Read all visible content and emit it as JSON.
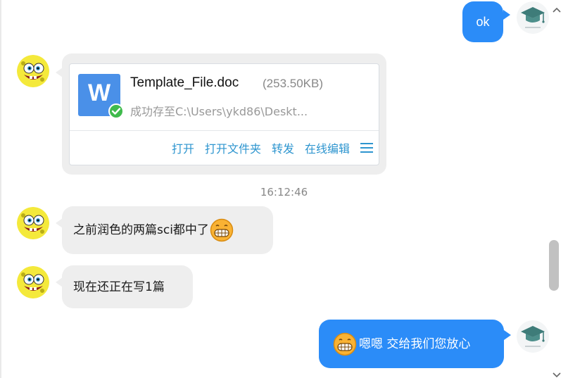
{
  "messages": [
    {
      "id": "m1",
      "direction": "out",
      "text": "ok"
    },
    {
      "id": "m2",
      "direction": "in",
      "type": "file"
    },
    {
      "id": "m3",
      "direction": "in",
      "text": "之前润色的两篇sci都中了",
      "emoji": "grin-emoji"
    },
    {
      "id": "m4",
      "direction": "in",
      "text": "现在还正在写1篇"
    },
    {
      "id": "m5",
      "direction": "out",
      "text": "嗯嗯 交给我们您放心",
      "emoji": "grin-emoji"
    }
  ],
  "file": {
    "icon_letter": "W",
    "name": "Template_File.doc",
    "size": "(253.50KB)",
    "status": "成功存至C:\\Users\\ykd86\\Deskt...",
    "actions": {
      "open": "打开",
      "open_folder": "打开文件夹",
      "forward": "转发",
      "online_edit": "在线编辑"
    }
  },
  "timestamp": "16:12:46",
  "colors": {
    "outgoing_bubble": "#2b8cf8",
    "incoming_bubble": "#eeeeee",
    "action_link": "#2d95cf",
    "file_icon": "#4a90e8",
    "success_check": "#3fba4c"
  },
  "icons": {
    "contact_avatar": "spongebob-avatar",
    "self_avatar": "graduation-cap-avatar",
    "emoji": "grin-emoji",
    "menu": "hamburger-menu-icon"
  }
}
